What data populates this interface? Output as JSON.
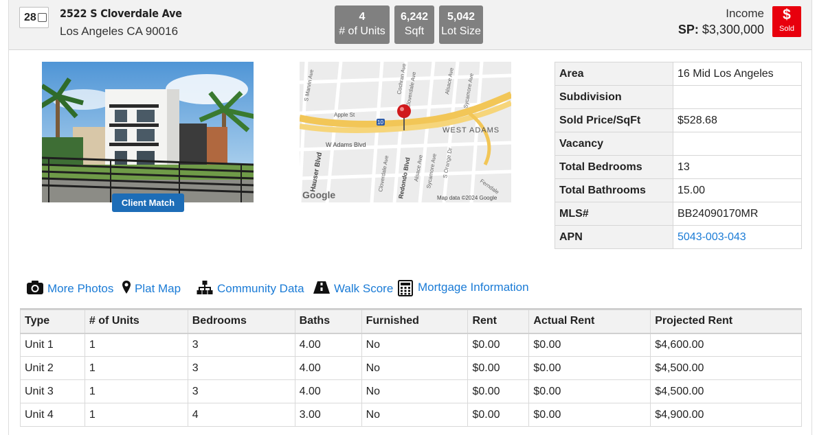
{
  "listing": {
    "index": "28",
    "address_line1": "2522 S Cloverdale Ave",
    "address_line2": "Los Angeles CA 90016",
    "property_type": "Income",
    "sp_label": "SP:",
    "sold_price": "$3,300,000",
    "status_symbol": "$",
    "status": "Sold",
    "status_color": "#e8000d"
  },
  "stats": {
    "units_value": "4",
    "units_label": "# of Units",
    "sqft_value": "6,242",
    "sqft_label": "Sqft",
    "lot_value": "5,042",
    "lot_label": "Lot Size"
  },
  "photo": {
    "badge": "Client Match"
  },
  "map": {
    "streets": {
      "marvin": "S Marvin Ave",
      "cochran": "Cochran Ave",
      "cloverdale_top": "Cloverdale Ave",
      "alsace_top": "Alsace Ave",
      "sycamore_top": "Sycamore Ave",
      "apple": "Apple St",
      "freeway": "10",
      "district": "WEST ADAMS",
      "wadams": "W Adams Blvd",
      "hauser": "Hauser Blvd",
      "cloverdale_bot": "Cloverdale Ave",
      "redondo": "Redondo Blvd",
      "alsace_bot": "Alsace Ave",
      "sycamore_bot": "Sycamore Ave",
      "orange": "S Orange Dr",
      "ferndale": "Ferndale"
    },
    "logo": "Google",
    "attribution": "Map data ©2024 Google"
  },
  "details": [
    {
      "label": "Area",
      "value": "16 Mid Los Angeles"
    },
    {
      "label": "Subdivision",
      "value": ""
    },
    {
      "label": "Sold Price/SqFt",
      "value": "$528.68"
    },
    {
      "label": "Vacancy",
      "value": ""
    },
    {
      "label": "Total Bedrooms",
      "value": "13"
    },
    {
      "label": "Total Bathrooms",
      "value": "15.00"
    },
    {
      "label": "MLS#",
      "value": "BB24090170MR"
    },
    {
      "label": "APN",
      "value": "5043-003-043"
    }
  ],
  "links": {
    "photos": "More Photos",
    "plat": "Plat Map",
    "community": "Community Data",
    "walk": "Walk Score",
    "mortgage": "Mortgage Information"
  },
  "units_table": {
    "headers": [
      "Type",
      "# of Units",
      "Bedrooms",
      "Baths",
      "Furnished",
      "Rent",
      "Actual Rent",
      "Projected Rent"
    ],
    "rows": [
      [
        "Unit 1",
        "1",
        "3",
        "4.00",
        "No",
        "$0.00",
        "$0.00",
        "$4,600.00"
      ],
      [
        "Unit 2",
        "1",
        "3",
        "4.00",
        "No",
        "$0.00",
        "$0.00",
        "$4,500.00"
      ],
      [
        "Unit 3",
        "1",
        "3",
        "4.00",
        "No",
        "$0.00",
        "$0.00",
        "$4,500.00"
      ],
      [
        "Unit 4",
        "1",
        "4",
        "3.00",
        "No",
        "$0.00",
        "$0.00",
        "$4,900.00"
      ]
    ]
  },
  "colors": {
    "link": "#1a7bd6",
    "stat_box": "#808080",
    "client_match": "#1d6db7"
  },
  "icons": [
    "camera-icon",
    "map-pin-icon",
    "sitemap-icon",
    "road-icon",
    "calculator-icon"
  ]
}
